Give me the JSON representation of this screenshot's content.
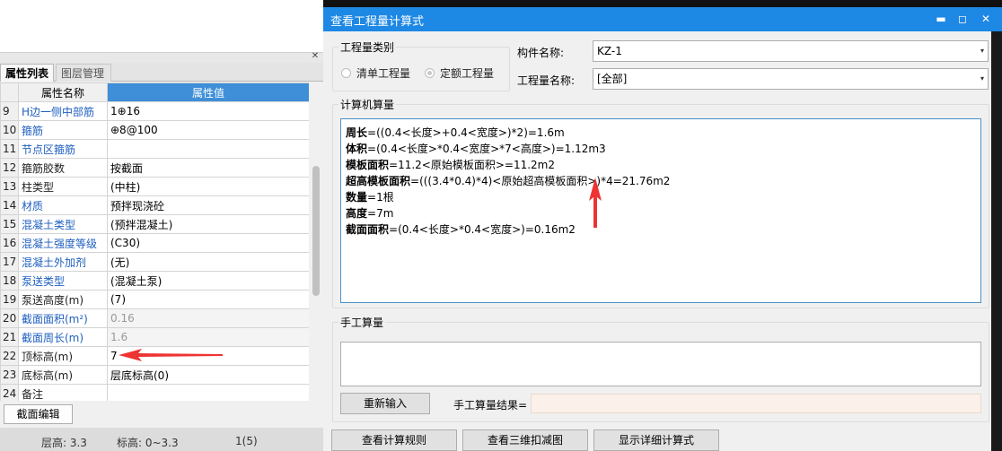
{
  "left_panel": {
    "tabs": [
      "属性列表",
      "图层管理"
    ],
    "close_glyph": "✕",
    "table": {
      "headers": [
        "",
        "属性名称",
        "属性值"
      ],
      "rows": [
        {
          "num": "9",
          "name": "H边一侧中部筋",
          "value": "1⊕16",
          "name_blue": true,
          "value_gray": false
        },
        {
          "num": "10",
          "name": "箍筋",
          "value": "⊕8@100",
          "name_blue": true,
          "value_gray": false
        },
        {
          "num": "11",
          "name": "节点区箍筋",
          "value": "",
          "name_blue": true,
          "value_gray": false
        },
        {
          "num": "12",
          "name": "箍筋胶数",
          "value": "按截面",
          "name_blue": false,
          "value_gray": false
        },
        {
          "num": "13",
          "name": "柱类型",
          "value": "(中柱)",
          "name_blue": false,
          "value_gray": false
        },
        {
          "num": "14",
          "name": "材质",
          "value": "预拌现浇砼",
          "name_blue": true,
          "value_gray": false
        },
        {
          "num": "15",
          "name": "混凝土类型",
          "value": "(预拌混凝土)",
          "name_blue": true,
          "value_gray": false
        },
        {
          "num": "16",
          "name": "混凝土强度等级",
          "value": "(C30)",
          "name_blue": true,
          "value_gray": false
        },
        {
          "num": "17",
          "name": "混凝土外加剂",
          "value": "(无)",
          "name_blue": true,
          "value_gray": false
        },
        {
          "num": "18",
          "name": "泵送类型",
          "value": "(混凝土泵)",
          "name_blue": true,
          "value_gray": false
        },
        {
          "num": "19",
          "name": "泵送高度(m)",
          "value": "(7)",
          "name_blue": false,
          "value_gray": false
        },
        {
          "num": "20",
          "name": "截面面积(m²)",
          "value": "0.16",
          "name_blue": true,
          "value_gray": true
        },
        {
          "num": "21",
          "name": "截面周长(m)",
          "value": "1.6",
          "name_blue": true,
          "value_gray": true
        },
        {
          "num": "22",
          "name": "顶标高(m)",
          "value": "7",
          "name_blue": false,
          "value_gray": false
        },
        {
          "num": "23",
          "name": "底标高(m)",
          "value": "层底标高(0)",
          "name_blue": false,
          "value_gray": false
        },
        {
          "num": "24",
          "name": "备注",
          "value": "",
          "name_blue": false,
          "value_gray": false
        }
      ]
    },
    "section_edit_button": "截面编辑",
    "status": {
      "floor_height": "层高:  3.3",
      "elevation": "标高:  0~3.3",
      "count": "1(5)"
    }
  },
  "dialog": {
    "title": "查看工程量计算式",
    "window_buttons": {
      "minimize": "▬",
      "maximize": "◻",
      "close": "✕"
    },
    "quantity_type": {
      "legend": "工程量类别",
      "options": [
        {
          "label": "清单工程量",
          "selected": false
        },
        {
          "label": "定额工程量",
          "selected": true
        }
      ]
    },
    "component_name_label": "构件名称:",
    "component_name_value": "KZ-1",
    "quantity_name_label": "工程量名称:",
    "quantity_name_value": "[全部]",
    "computer_calc": {
      "legend": "计算机算量",
      "lines": [
        {
          "label": "周长",
          "formula": "=((0.4<长度>+0.4<宽度>)*2)=1.6m"
        },
        {
          "label": "体积",
          "formula": "=(0.4<长度>*0.4<宽度>*7<高度>)=1.12m3"
        },
        {
          "label": "模板面积",
          "formula": "=11.2<原始模板面积>=11.2m2"
        },
        {
          "label": "超高模板面积",
          "formula": "=(((3.4*0.4)*4)<原始超高模板面积>)*4=21.76m2"
        },
        {
          "label": "数量",
          "formula": "=1根"
        },
        {
          "label": "高度",
          "formula": "=7m"
        },
        {
          "label": "截面面积",
          "formula": "=(0.4<长度>*0.4<宽度>)=0.16m2"
        }
      ]
    },
    "manual_calc": {
      "legend": "手工算量",
      "reenter_button": "重新输入",
      "result_label": "手工算量结果="
    },
    "bottom_buttons": [
      "查看计算规则",
      "查看三维扣减图",
      "显示详细计算式"
    ],
    "dropdown_glyph": "▾"
  },
  "colors": {
    "title_bar": "#1e88e5",
    "header_value": "#3f8fd8",
    "link_blue": "#1f5fbf",
    "annotation_red": "#ee3333"
  }
}
